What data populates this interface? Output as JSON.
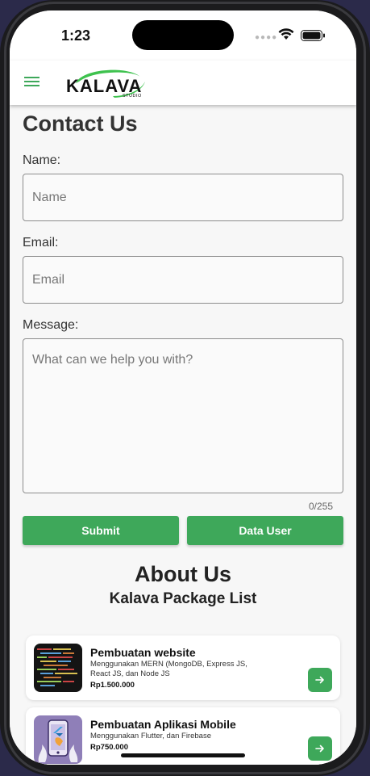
{
  "status_bar": {
    "time": "1:23"
  },
  "app_bar": {
    "logo_text": "KALAVA",
    "logo_subtext": "STUDIO",
    "menu_icon": "hamburger-menu-icon"
  },
  "contact_form": {
    "title": "Contact Us",
    "name_label": "Name:",
    "name_placeholder": "Name",
    "email_label": "Email:",
    "email_placeholder": "Email",
    "message_label": "Message:",
    "message_placeholder": "What can we help you with?",
    "char_counter": "0/255",
    "submit_label": "Submit",
    "data_user_label": "Data User"
  },
  "about": {
    "title": "About Us",
    "subtitle": "Kalava Package List"
  },
  "packages": [
    {
      "name": "Pembuatan website",
      "description": "Menggunakan MERN (MongoDB, Express JS, React JS, dan Node JS",
      "price": "Rp1.500.000",
      "icon": "code-screen-thumbnail"
    },
    {
      "name": "Pembuatan Aplikasi Mobile",
      "description": "Menggunakan Flutter, dan Firebase",
      "price": "Rp750.000",
      "icon": "mobile-app-thumbnail"
    }
  ],
  "colors": {
    "primary_green": "#3ea85a",
    "background": "#f7f7f7"
  }
}
